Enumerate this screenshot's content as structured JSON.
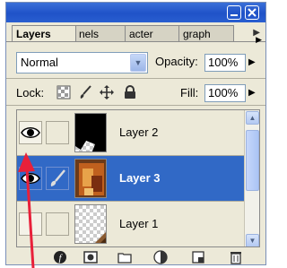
{
  "panel": {
    "tabs": [
      {
        "label": "Layers",
        "active": true
      },
      {
        "label": "nels",
        "active": false
      },
      {
        "label": "acter",
        "active": false
      },
      {
        "label": "graph",
        "active": false
      }
    ],
    "blend_mode": "Normal",
    "opacity_label": "Opacity:",
    "opacity_value": "100%",
    "lock_label": "Lock:",
    "fill_label": "Fill:",
    "fill_value": "100%"
  },
  "layers": [
    {
      "name": "Layer 2",
      "visible": true,
      "selected": false,
      "thumbnail": "black-shape-on-transparent"
    },
    {
      "name": "Layer 3",
      "visible": true,
      "selected": true,
      "thumbnail": "photo"
    },
    {
      "name": "Layer 1",
      "visible": false,
      "selected": false,
      "thumbnail": "transparent-with-image-corner"
    }
  ],
  "icons": {
    "lock": [
      "lock-transparent-icon",
      "lock-paint-icon",
      "lock-move-icon",
      "lock-all-icon"
    ],
    "bottom": [
      "layer-style-icon",
      "layer-mask-icon",
      "new-group-icon",
      "adjustment-layer-icon",
      "new-layer-icon",
      "delete-layer-icon"
    ]
  },
  "colors": {
    "selection": "#3169c6",
    "annotation_arrow": "#e8203a",
    "titlebar": "#2a5fd0"
  }
}
